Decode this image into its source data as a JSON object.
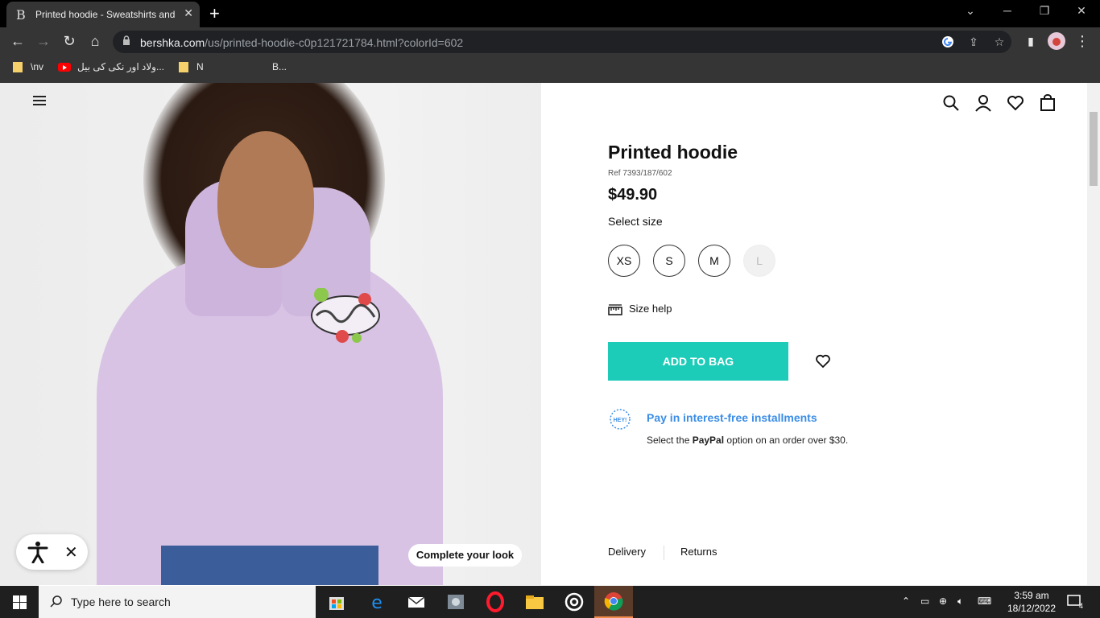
{
  "browser": {
    "tab_title": "Printed hoodie - Sweatshirts and",
    "tab_favicon": "B",
    "new_tab": "+",
    "url_host": "bershka.com",
    "url_path": "/us/printed-hoodie-c0p121721784.html?colorId=602",
    "bookmarks": [
      {
        "label": "\\nv",
        "icon": "folder-icon"
      },
      {
        "label": "ولاد اور نکی کی بیل...",
        "icon": "youtube-icon"
      },
      {
        "label": "N",
        "icon": "folder-icon"
      },
      {
        "label": "B...",
        "icon": "none"
      }
    ]
  },
  "page": {
    "complete_look": "Complete your look",
    "product": {
      "name": "Printed hoodie",
      "ref": "Ref 7393/187/602",
      "price": "$49.90",
      "select_size_label": "Select size",
      "sizes": [
        {
          "label": "XS",
          "available": true
        },
        {
          "label": "S",
          "available": true
        },
        {
          "label": "M",
          "available": true
        },
        {
          "label": "L",
          "available": false
        }
      ],
      "size_help": "Size help",
      "add_to_bag": "ADD TO BAG"
    },
    "installments": {
      "badge": "HEY!",
      "title": "Pay in interest-free installments",
      "text_before": "Select the ",
      "text_bold": "PayPal",
      "text_after": " option on an order over $30."
    },
    "bottom_tabs": [
      "Delivery",
      "Returns"
    ],
    "accent_color": "#1dccb8",
    "link_color": "#3b8de6"
  },
  "taskbar": {
    "search_placeholder": "Type here to search",
    "time": "3:59 am",
    "date": "18/12/2022",
    "notification_count": "4"
  }
}
